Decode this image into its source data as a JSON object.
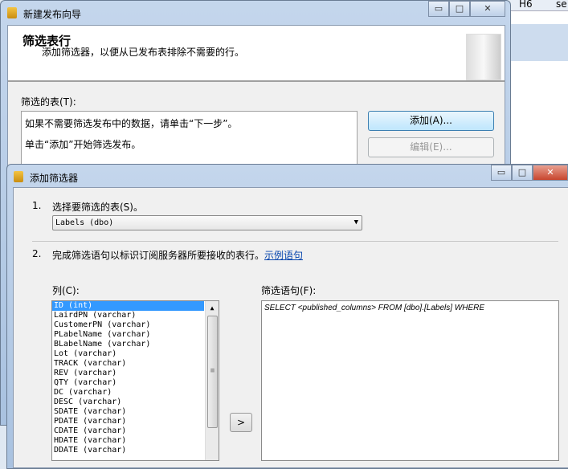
{
  "background": {
    "cell1": "H6",
    "cell2": "se"
  },
  "wizard": {
    "title": "新建发布向导",
    "header_title": "筛选表行",
    "header_subtitle": "添加筛选器，以便从已发布表排除不需要的行。",
    "filtered_tables_label": "筛选的表(T):",
    "info_line1": "如果不需要筛选发布中的数据，请单击“下一步”。",
    "info_line2": "单击“添加”开始筛选发布。",
    "add_button": "添加(A)...",
    "edit_button": "编辑(E)..."
  },
  "dialog": {
    "title": "添加筛选器",
    "step1_num": "1.",
    "step1_text": "选择要筛选的表(S)。",
    "table_selected": "Labels (dbo)",
    "step2_num": "2.",
    "step2_text": "完成筛选语句以标识订阅服务器所要接收的表行。",
    "example_link": "示例语句",
    "columns_label": "列(C):",
    "filter_label": "筛选语句(F):",
    "columns": [
      "ID (int)",
      "LairdPN (varchar)",
      "CustomerPN (varchar)",
      "PLabelName (varchar)",
      "BLabelName (varchar)",
      "Lot (varchar)",
      "TRACK (varchar)",
      "REV (varchar)",
      "QTY (varchar)",
      "DC (varchar)",
      "DESC (varchar)",
      "SDATE (varchar)",
      "PDATE (varchar)",
      "CDATE (varchar)",
      "HDATE (varchar)",
      "DDATE (varchar)"
    ],
    "selected_column": "ID (int)",
    "insert_button": ">",
    "filter_statement": "SELECT <published_columns> FROM [dbo].[Labels] WHERE"
  }
}
